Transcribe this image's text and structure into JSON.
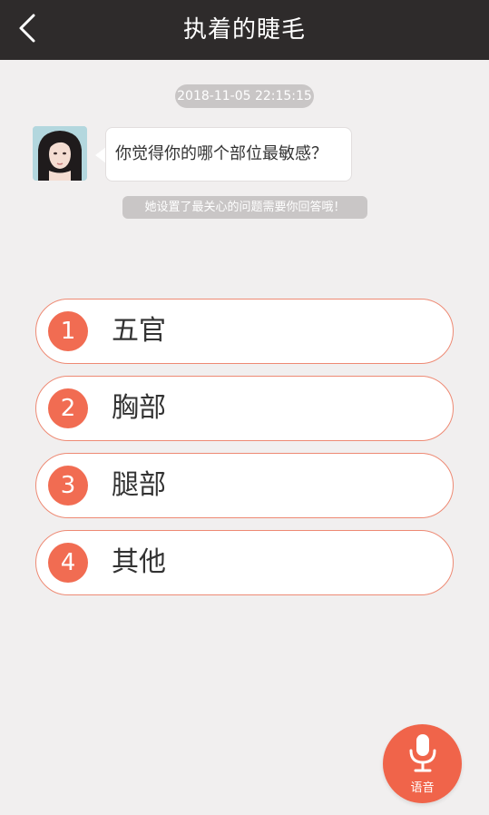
{
  "header": {
    "title": "执着的睫毛",
    "back_icon": "chevron-left-icon"
  },
  "chat": {
    "timestamp": "2018-11-05 22:15:15",
    "message": "你觉得你的哪个部位最敏感？",
    "hint": "她设置了最关心的问题需要你回答哦！"
  },
  "options": [
    {
      "num": "1",
      "label": "五官"
    },
    {
      "num": "2",
      "label": "胸部"
    },
    {
      "num": "3",
      "label": "腿部"
    },
    {
      "num": "4",
      "label": "其他"
    }
  ],
  "voice": {
    "label": "语音",
    "icon": "microphone-icon"
  },
  "colors": {
    "header_bg": "#2e2b2b",
    "page_bg": "#f1efef",
    "accent": "#f16c52",
    "option_border": "#ee8a74",
    "pill_bg": "#c9c6c6"
  }
}
